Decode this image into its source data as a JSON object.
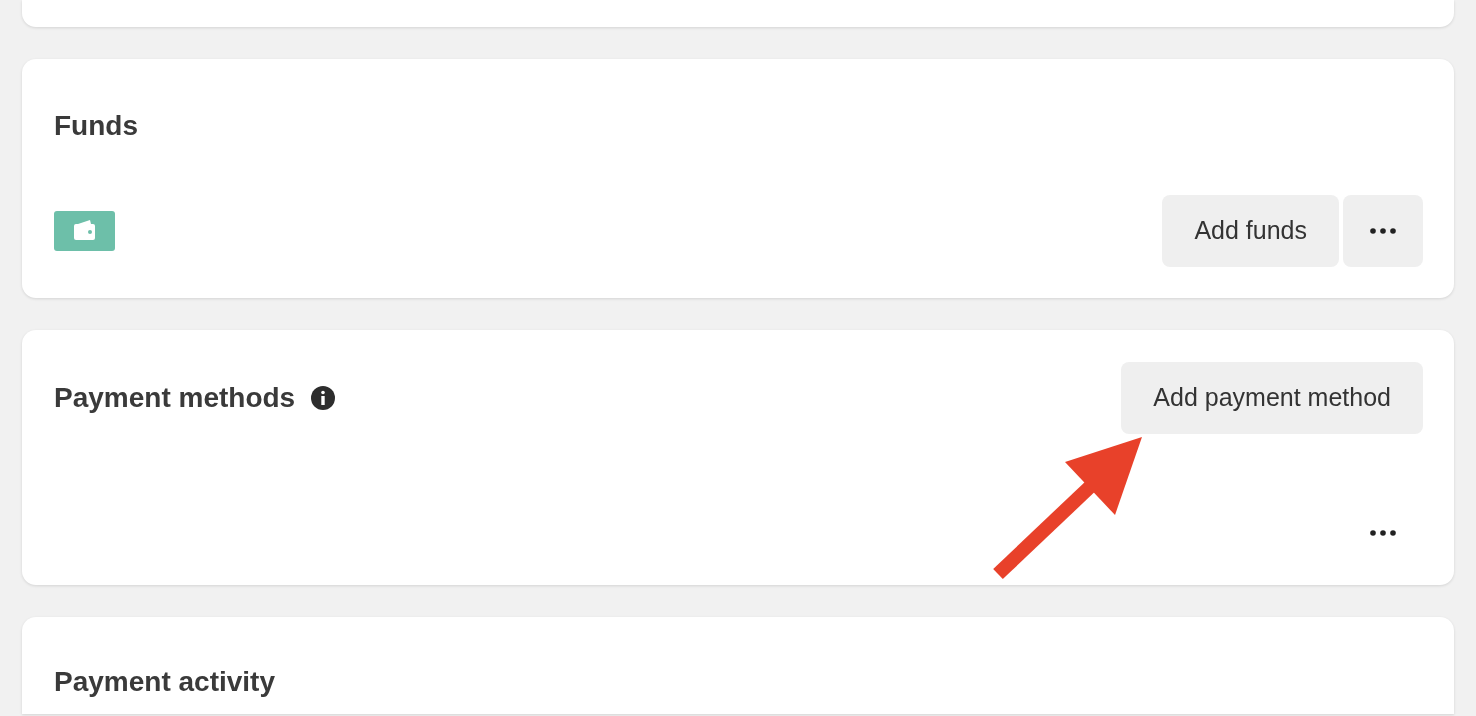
{
  "funds": {
    "title": "Funds",
    "buttons": [
      {
        "label": "Add funds"
      }
    ]
  },
  "payment_methods": {
    "title": "Payment methods",
    "button": "Add payment method"
  },
  "payment_activity": {
    "title": "Payment activity"
  }
}
